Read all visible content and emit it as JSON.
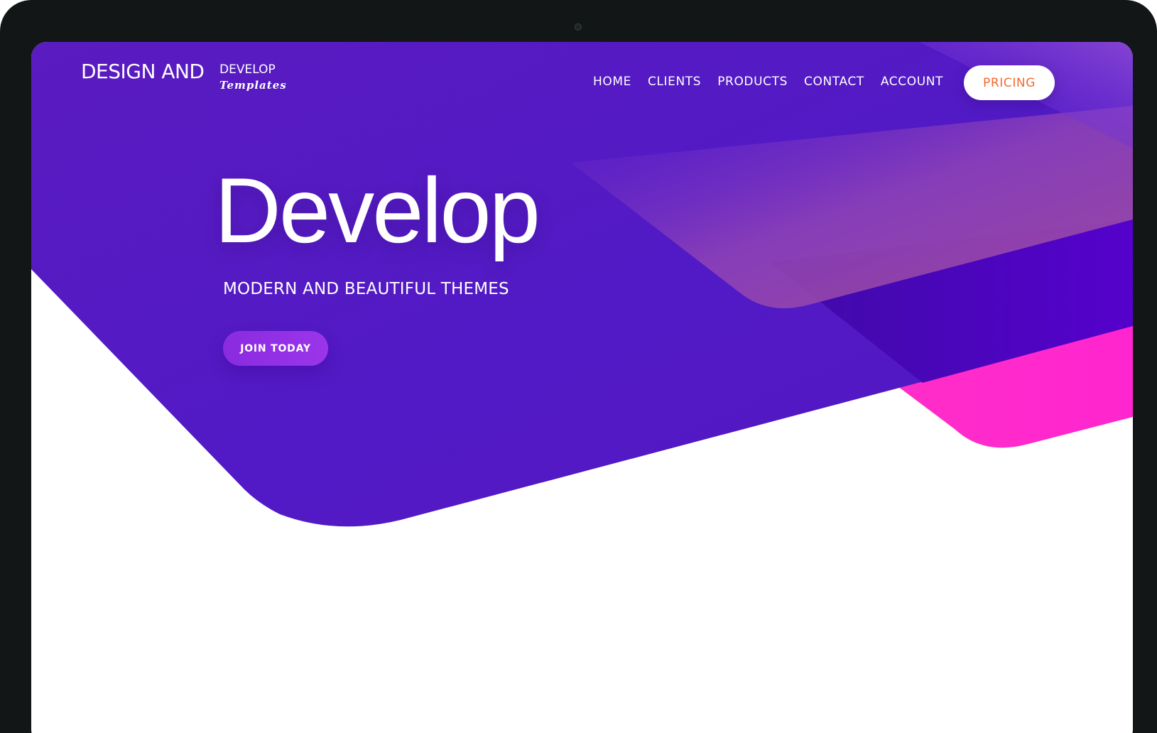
{
  "brand": {
    "main": "DESIGN AND",
    "sub": "DEVELOP",
    "script": "Templates"
  },
  "nav": {
    "items": [
      {
        "label": "HOME"
      },
      {
        "label": "CLIENTS"
      },
      {
        "label": "PRODUCTS"
      },
      {
        "label": "CONTACT"
      },
      {
        "label": "ACCOUNT"
      }
    ],
    "cta": "PRICING"
  },
  "hero": {
    "title": "Develop",
    "subtitle": "MODERN AND BEAUTIFUL THEMES",
    "button": "JOIN TODAY"
  },
  "colors": {
    "primary": "#551bc2",
    "accent_pink": "#ff29c9",
    "cta_text": "#f26a2e",
    "bezel": "#121617"
  }
}
